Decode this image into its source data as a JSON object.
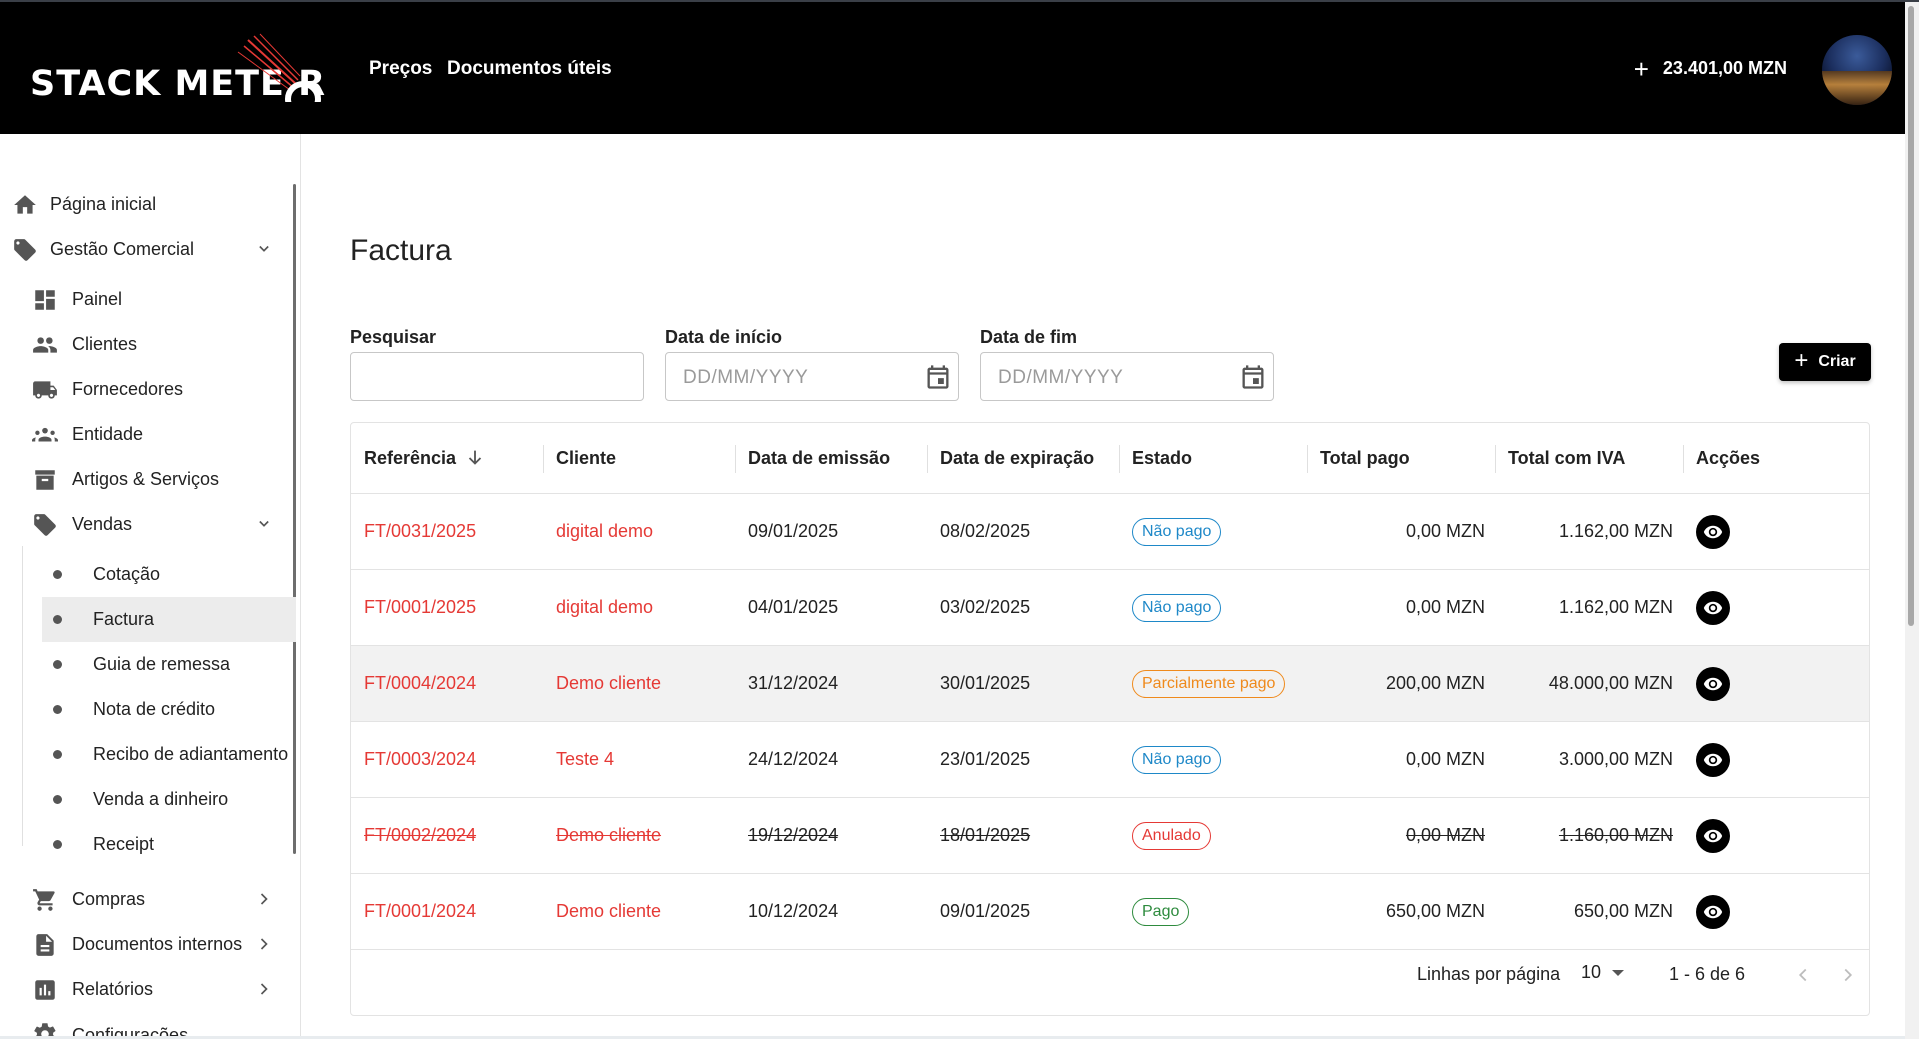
{
  "header": {
    "logo_text": "STACK METE  R",
    "nav": [
      "Preços",
      "Documentos úteis"
    ],
    "balance": "23.401,00 MZN"
  },
  "sidebar": {
    "items": [
      {
        "label": "Página inicial",
        "icon": "home-icon"
      },
      {
        "label": "Gestão Comercial",
        "icon": "tag-icon"
      },
      {
        "label": "Painel",
        "icon": "dashboard-icon"
      },
      {
        "label": "Clientes",
        "icon": "people-icon"
      },
      {
        "label": "Fornecedores",
        "icon": "truck-icon"
      },
      {
        "label": "Entidade",
        "icon": "groups-icon"
      },
      {
        "label": "Artigos & Serviços",
        "icon": "archive-icon"
      },
      {
        "label": "Vendas",
        "icon": "tag-icon"
      },
      {
        "label": "Cotação"
      },
      {
        "label": "Factura"
      },
      {
        "label": "Guia de remessa"
      },
      {
        "label": "Nota de crédito"
      },
      {
        "label": "Recibo de adiantamento"
      },
      {
        "label": "Venda a dinheiro"
      },
      {
        "label": "Receipt"
      },
      {
        "label": "Compras",
        "icon": "cart-icon"
      },
      {
        "label": "Documentos internos",
        "icon": "document-icon"
      },
      {
        "label": "Relatórios",
        "icon": "report-icon"
      },
      {
        "label": "Configurações",
        "icon": "gear-icon"
      }
    ]
  },
  "main": {
    "title": "Factura",
    "search_label": "Pesquisar",
    "start_label": "Data de início",
    "end_label": "Data de fim",
    "date_placeholder": "DD/MM/YYYY",
    "create_label": "Criar"
  },
  "table": {
    "columns": [
      "Referência",
      "Cliente",
      "Data de emissão",
      "Data de expiração",
      "Estado",
      "Total pago",
      "Total com IVA",
      "Acções"
    ],
    "rows": [
      {
        "ref": "FT/0031/2025",
        "client": "digital demo",
        "issued": "09/01/2025",
        "expires": "08/02/2025",
        "status": "Não pago",
        "paid": "0,00 MZN",
        "total": "1.162,00 MZN"
      },
      {
        "ref": "FT/0001/2025",
        "client": "digital demo",
        "issued": "04/01/2025",
        "expires": "03/02/2025",
        "status": "Não pago",
        "paid": "0,00 MZN",
        "total": "1.162,00 MZN"
      },
      {
        "ref": "FT/0004/2024",
        "client": "Demo cliente",
        "issued": "31/12/2024",
        "expires": "30/01/2025",
        "status": "Parcialmente pago",
        "paid": "200,00 MZN",
        "total": "48.000,00 MZN"
      },
      {
        "ref": "FT/0003/2024",
        "client": "Teste 4",
        "issued": "24/12/2024",
        "expires": "23/01/2025",
        "status": "Não pago",
        "paid": "0,00 MZN",
        "total": "3.000,00 MZN"
      },
      {
        "ref": "FT/0002/2024",
        "client": "Demo cliente",
        "issued": "19/12/2024",
        "expires": "18/01/2025",
        "status": "Anulado",
        "paid": "0,00 MZN",
        "total": "1.160,00 MZN"
      },
      {
        "ref": "FT/0001/2024",
        "client": "Demo cliente",
        "issued": "10/12/2024",
        "expires": "09/01/2025",
        "status": "Pago",
        "paid": "650,00 MZN",
        "total": "650,00 MZN"
      }
    ],
    "rows_per_page_label": "Linhas por página",
    "rows_per_page": "10",
    "range": "1 - 6 de 6"
  },
  "colors": {
    "accent_red": "#e53935",
    "unpaid": "#1e88c8",
    "partial": "#ef8a1c",
    "paid": "#2e8b3e",
    "header_bg": "#000000"
  }
}
